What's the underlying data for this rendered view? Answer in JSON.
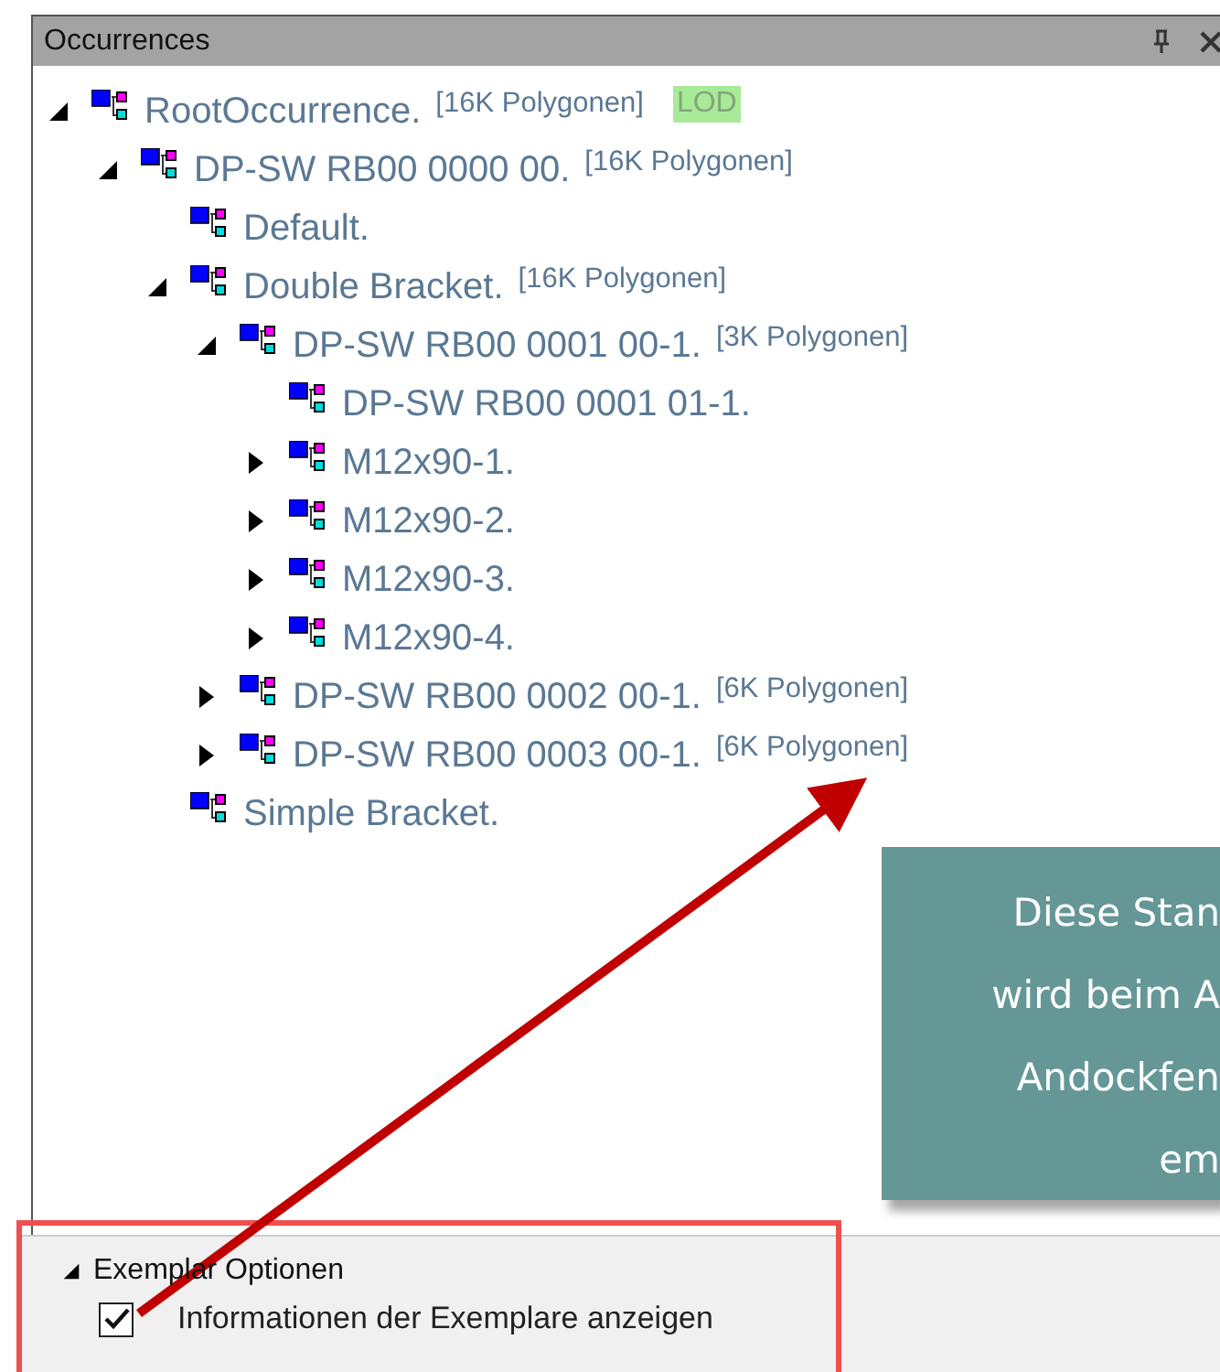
{
  "window": {
    "title": "Occurrences"
  },
  "tree": [
    {
      "name": "RootOccurrence.",
      "polygons": "[16K Polygonen]",
      "badge": "LOD",
      "expanded": true,
      "children": [
        {
          "name": "DP-SW RB00 0000 00.",
          "polygons": "[16K Polygonen]",
          "expanded": true,
          "children": [
            {
              "name": "Default."
            },
            {
              "name": "Double Bracket.",
              "polygons": "[16K Polygonen]",
              "expanded": true,
              "children": [
                {
                  "name": "DP-SW RB00 0001 00-1.",
                  "polygons": "[3K Polygonen]",
                  "expanded": true,
                  "children": [
                    {
                      "name": "DP-SW RB00 0001 01-1."
                    },
                    {
                      "name": "M12x90-1.",
                      "expanded": false
                    },
                    {
                      "name": "M12x90-2.",
                      "expanded": false
                    },
                    {
                      "name": "M12x90-3.",
                      "expanded": false
                    },
                    {
                      "name": "M12x90-4.",
                      "expanded": false
                    }
                  ]
                },
                {
                  "name": "DP-SW RB00 0002 00-1.",
                  "polygons": "[6K Polygonen]",
                  "expanded": false
                },
                {
                  "name": "DP-SW RB00 0003 00-1.",
                  "polygons": "[6K Polygonen]",
                  "expanded": false
                }
              ]
            },
            {
              "name": "Simple Bracket."
            }
          ]
        }
      ]
    }
  ],
  "options": {
    "title": "Exemplar Optionen",
    "expanded": true,
    "checkbox": {
      "label": "Informationen der Exemplare anzeigen",
      "checked": true
    }
  },
  "callout": {
    "lines": [
      "Diese Stan",
      "wird beim A",
      "Andockfen",
      "em"
    ]
  }
}
